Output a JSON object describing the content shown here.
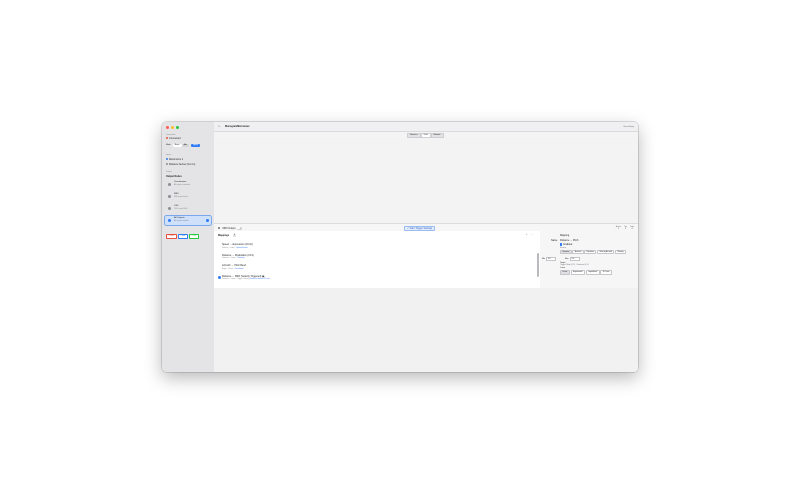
{
  "sidebar": {
    "section_connection": "Connection",
    "device_status": "Connected",
    "mode_label": "Mode",
    "mode_options": [
      "Basic",
      "Adv"
    ],
    "apply_label": "Apply",
    "section_inputs": "Inputs",
    "inputs": [
      {
        "label": "Metronome 1"
      },
      {
        "label": "Distance Sensor (12 cm)"
      }
    ],
    "section_outputs": "Output",
    "output_nodes_label": "Output Nodes",
    "nodes": [
      {
        "title": "Visualization",
        "sub": "All outputs visualized",
        "color": "#8e8e93"
      },
      {
        "title": "MIDI",
        "sub": "MIDI output device",
        "color": "#8e8e93"
      },
      {
        "title": "OSC",
        "sub": "OSC to port 9000",
        "color": "#8e8e93"
      },
      {
        "title": "All Outputs",
        "sub": "All outputs enabled",
        "color": "#2f7cf6",
        "selected": true
      }
    ],
    "status_chips": [
      {
        "label": "4 Conn",
        "color": "#e8503a"
      },
      {
        "label": "2 Midi",
        "color": "#2f7cf6"
      },
      {
        "label": "1 Osc",
        "color": "#28c840"
      }
    ]
  },
  "toolbar": {
    "title": "MonogramMicrotuner",
    "right_label": "Clear History"
  },
  "tabs": [
    {
      "label": "Sources",
      "active": false
    },
    {
      "label": "Grid",
      "active": true
    },
    {
      "label": "Monitor",
      "active": false
    }
  ],
  "controls": {
    "midi_output_label": "MIDI Output",
    "trigger_label": "Start Trigger Settings",
    "counters": [
      {
        "label": "Active",
        "value": "1"
      },
      {
        "label": "Out",
        "value": "2"
      },
      {
        "label": "Total",
        "value": "4"
      }
    ]
  },
  "mappings": {
    "title": "Mappings",
    "count": "4",
    "rows": [
      {
        "title": "Speed → Expression (CC11)",
        "detail": "Velocity · Linear ·",
        "link": "Speed Sensor"
      },
      {
        "title": "Distance → Modulation (CC1)",
        "detail": "Distance · Linear ·",
        "link": "Proximity"
      },
      {
        "title": "Azimuth → Pitch Bend",
        "detail": "Angle · Linear ·",
        "link": "Orientation"
      },
      {
        "title": "Distance → MIDI (Velocity Triggered)",
        "detail": "Distance · Linear · Trigger Velocity",
        "link": "Distance Sensor (12 cm)"
      }
    ]
  },
  "inspector": {
    "section_title": "Mapping",
    "name_label": "Name",
    "name_value": "Distance → Pitch",
    "enabled_label": "Enabled",
    "source_label": "Source",
    "source_options": [
      "Distance",
      "Azimuth",
      "Elevation",
      "Velocity Ascend",
      "Velocity"
    ],
    "min_label": "Min",
    "min_value": "0.0",
    "max_label": "Max",
    "max_value": "5.0",
    "target_label": "Target",
    "target_value": "Trigger Note (CC) · Distance (0–1)",
    "curve_label": "Curve",
    "curve_options": [
      "Linear",
      "Exponential",
      "Logarithmic",
      "S-Curve"
    ]
  }
}
